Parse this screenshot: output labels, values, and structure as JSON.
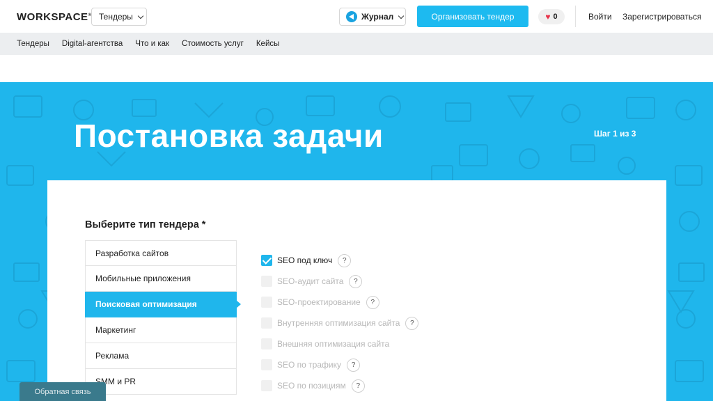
{
  "header": {
    "logo": "WORKSPACE",
    "logo_reg": "®",
    "tenders_dropdown": "Тендеры",
    "journal_dropdown": "Журнал",
    "cta_label": "Организовать тендер",
    "likes_count": "0",
    "login": "Войти",
    "register": "Зарегистрироваться"
  },
  "subnav": {
    "items": [
      "Тендеры",
      "Digital-агентства",
      "Что и как",
      "Стоимость услуг",
      "Кейсы"
    ]
  },
  "hero": {
    "title": "Постановка задачи",
    "step": "Шаг 1 из 3"
  },
  "form": {
    "title": "Выберите тип тендера *",
    "types": [
      "Разработка сайтов",
      "Мобильные приложения",
      "Поисковая оптимизация",
      "Маркетинг",
      "Реклама",
      "SMM и PR"
    ],
    "active_type": "Поисковая оптимизация",
    "options": [
      {
        "label": "SEO под ключ",
        "checked": true,
        "enabled": true,
        "help": "?"
      },
      {
        "label": "SEO-аудит сайта",
        "checked": false,
        "enabled": false,
        "help": "?"
      },
      {
        "label": "SEO-проектирование",
        "checked": false,
        "enabled": false,
        "help": "?"
      },
      {
        "label": "Внутренняя оптимизация сайта",
        "checked": false,
        "enabled": false,
        "help": "?"
      },
      {
        "label": "Внешняя оптимизация сайта",
        "checked": false,
        "enabled": false,
        "help": ""
      },
      {
        "label": "SEO по трафику",
        "checked": false,
        "enabled": false,
        "help": "?"
      },
      {
        "label": "SEO по позициям",
        "checked": false,
        "enabled": false,
        "help": "?"
      }
    ]
  },
  "feedback_label": "Обратная связь",
  "colors": {
    "accent": "#1fb6ec",
    "cta": "#1dbaf0",
    "heart": "#e8334a"
  }
}
